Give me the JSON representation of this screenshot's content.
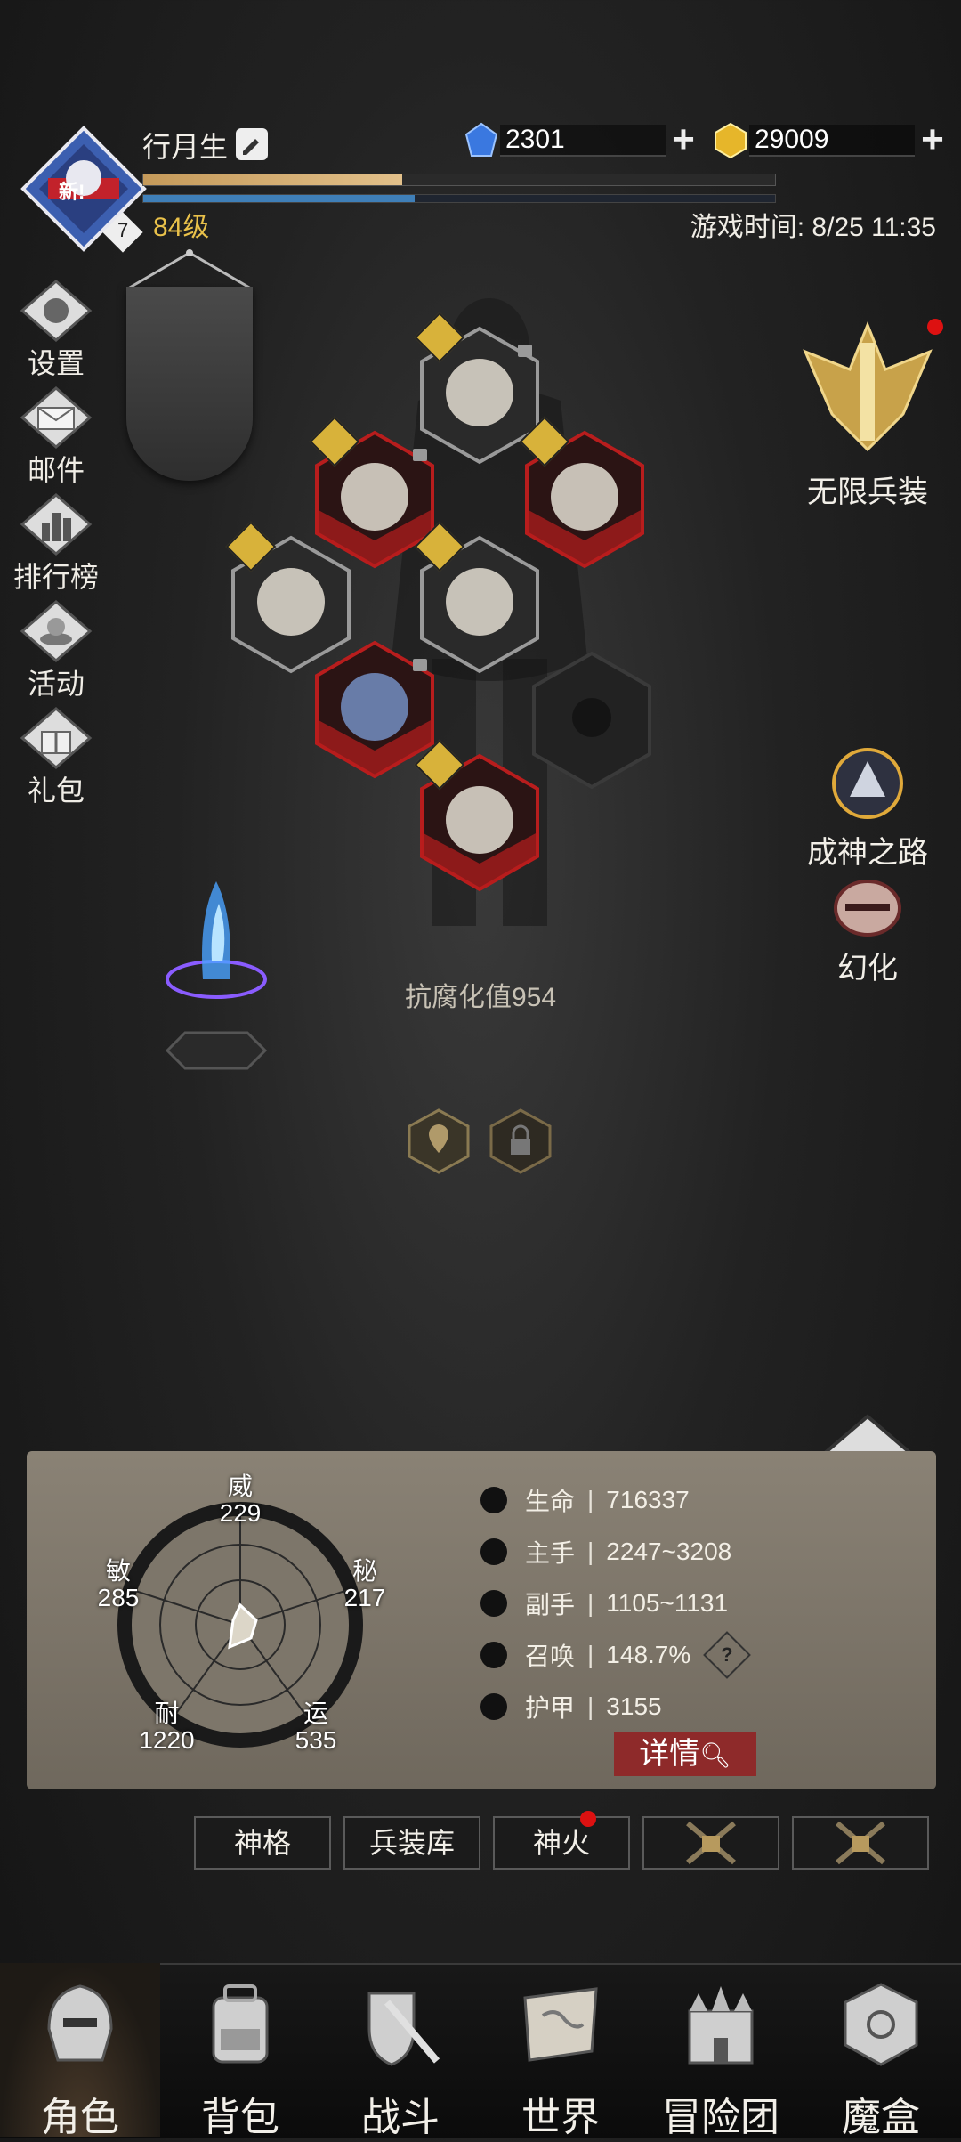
{
  "player": {
    "name": "行月生",
    "level": "84级",
    "badge": "新!",
    "rank_small": "7",
    "exp_fraction": 0.41,
    "mp_fraction": 0.43
  },
  "currency": {
    "gems": "2301",
    "gold": "29009"
  },
  "game_time": "游戏时间: 8/25 11:35",
  "side_menu": [
    {
      "label": "设置",
      "icon": "gear-icon"
    },
    {
      "label": "邮件",
      "icon": "mail-icon"
    },
    {
      "label": "排行榜",
      "icon": "ranking-icon"
    },
    {
      "label": "活动",
      "icon": "event-icon"
    },
    {
      "label": "礼包",
      "icon": "gift-icon"
    }
  ],
  "right_menu": {
    "infinite_gear": "无限兵装",
    "godhood_path": "成神之路",
    "transform": "幻化"
  },
  "corrosion_resistance": "抗腐化值954",
  "attributes": {
    "wei": {
      "name": "威",
      "value": "229"
    },
    "mi": {
      "name": "秘",
      "value": "217"
    },
    "yun": {
      "name": "运",
      "value": "535"
    },
    "nai": {
      "name": "耐",
      "value": "1220"
    },
    "min": {
      "name": "敏",
      "value": "285"
    }
  },
  "stats": [
    {
      "name": "生命",
      "value": "716337",
      "icon": "heart-icon"
    },
    {
      "name": "主手",
      "value": "2247~3208",
      "icon": "main-hand-icon"
    },
    {
      "name": "副手",
      "value": "1105~1131",
      "icon": "off-hand-icon"
    },
    {
      "name": "召唤",
      "value": "148.7%",
      "icon": "summon-icon"
    },
    {
      "name": "护甲",
      "value": "3155",
      "icon": "armor-icon"
    }
  ],
  "detail_button": "详情",
  "sub_tabs": [
    "神格",
    "兵装库",
    "神火",
    "",
    ""
  ],
  "bottom_nav": [
    "角色",
    "背包",
    "战斗",
    "世界",
    "冒险团",
    "魔盒"
  ],
  "colors": {
    "accent_gold": "#e9c14a",
    "equip_red": "#b81d1d",
    "notify_red": "#d11"
  }
}
